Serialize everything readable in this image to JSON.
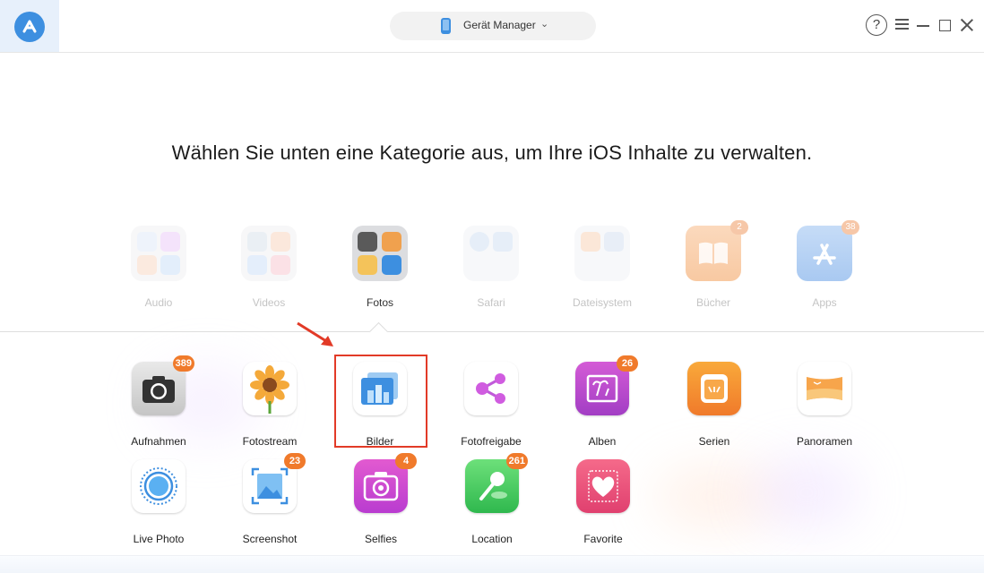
{
  "titlebar": {
    "device_selector": "Gerät Manager",
    "icons": [
      "app-logo-icon",
      "phone-icon",
      "chevron-down-icon",
      "help-icon",
      "menu-icon",
      "minimize-icon",
      "maximize-icon",
      "close-icon"
    ]
  },
  "headline": "Wählen Sie unten eine Kategorie aus, um Ihre iOS Inhalte zu verwalten.",
  "categories": [
    {
      "label": "Audio",
      "badge": ""
    },
    {
      "label": "Videos",
      "badge": ""
    },
    {
      "label": "Fotos",
      "badge": "",
      "active": true
    },
    {
      "label": "Safari",
      "badge": ""
    },
    {
      "label": "Dateisystem",
      "badge": ""
    },
    {
      "label": "Bücher",
      "badge": "2"
    },
    {
      "label": "Apps",
      "badge": "38"
    }
  ],
  "photo_items": [
    {
      "label": "Aufnahmen",
      "badge": "389"
    },
    {
      "label": "Fotostream",
      "badge": ""
    },
    {
      "label": "Bilder",
      "badge": "",
      "highlighted": true
    },
    {
      "label": "Fotofreigabe",
      "badge": ""
    },
    {
      "label": "Alben",
      "badge": "26"
    },
    {
      "label": "Serien",
      "badge": ""
    },
    {
      "label": "Panoramen",
      "badge": ""
    },
    {
      "label": "Live Photo",
      "badge": ""
    },
    {
      "label": "Screenshot",
      "badge": "23"
    },
    {
      "label": "Selfies",
      "badge": "4"
    },
    {
      "label": "Location",
      "badge": "261"
    },
    {
      "label": "Favorite",
      "badge": ""
    }
  ],
  "colors": {
    "accent": "#3d8fe0",
    "badge": "#f07a2b",
    "highlight": "#e23a27"
  }
}
